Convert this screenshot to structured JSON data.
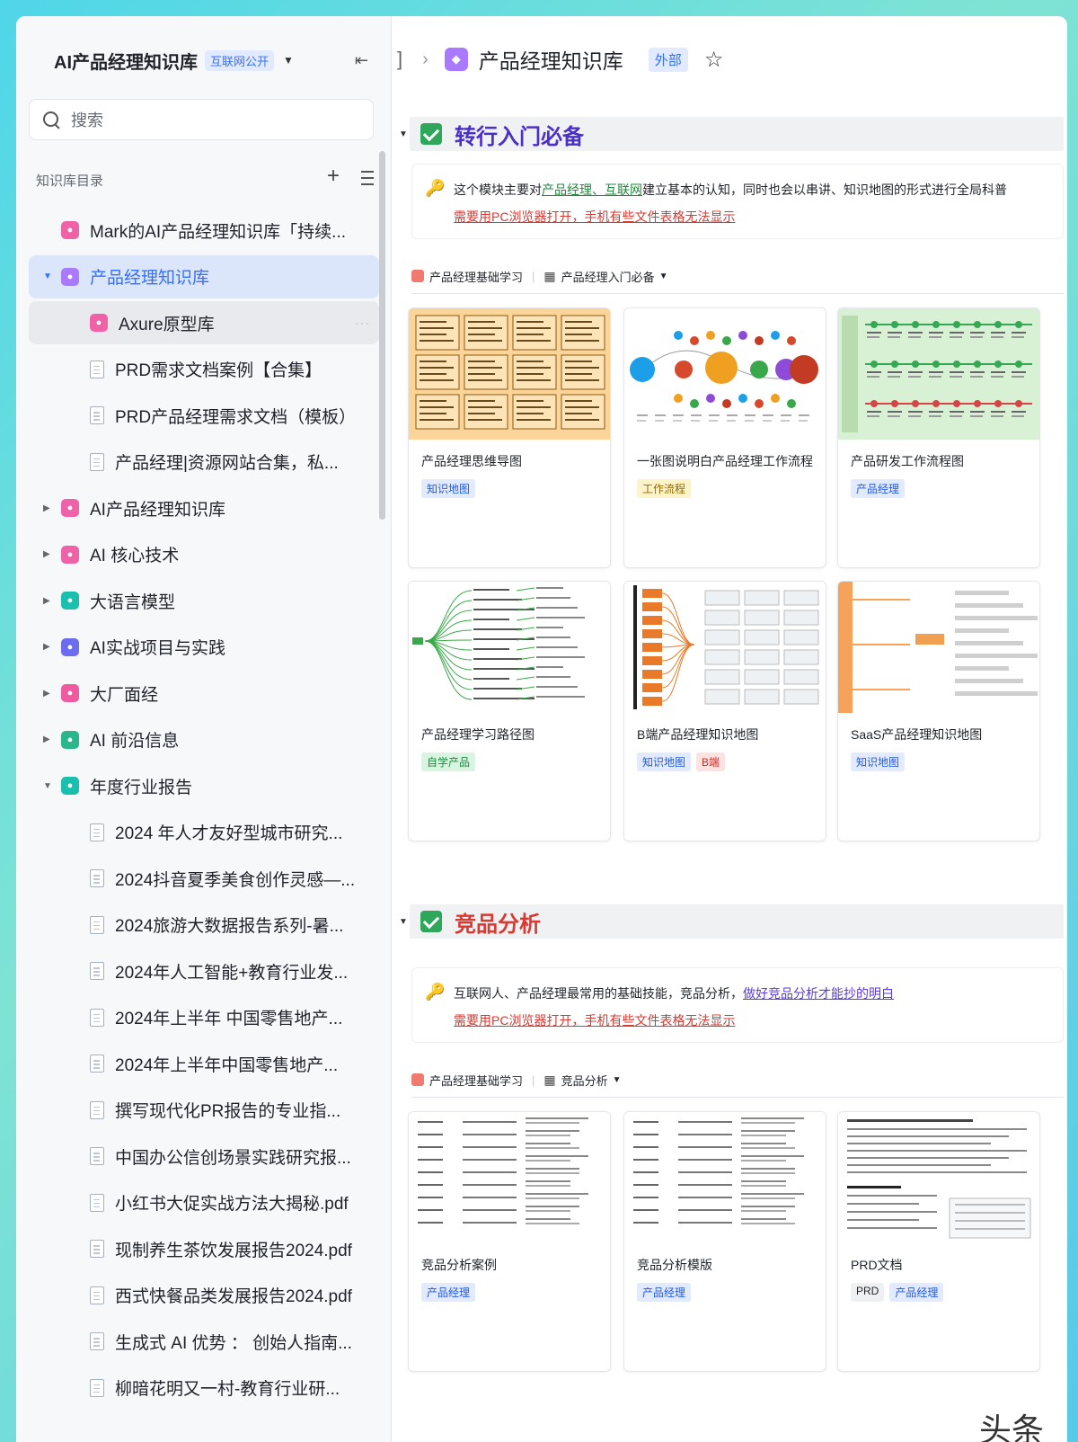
{
  "sidebar": {
    "title": "AI产品经理知识库",
    "visibility_tag": "互联网公开",
    "search_placeholder": "搜索",
    "directory_label": "知识库目录",
    "items": [
      {
        "label": "Mark的AI产品经理知识库「持续...",
        "kind": "space",
        "color": "#f062a8",
        "indent": 0
      },
      {
        "label": "产品经理知识库",
        "kind": "space",
        "color": "#a97aff",
        "indent": 0,
        "expanded": true,
        "active": true
      },
      {
        "label": "Axure原型库",
        "kind": "space",
        "color": "#f062a8",
        "indent": 1,
        "hover": true
      },
      {
        "label": "PRD需求文档案例【合集】",
        "kind": "doc",
        "indent": 1
      },
      {
        "label": "PRD产品经理需求文档（模板）",
        "kind": "doc",
        "indent": 1
      },
      {
        "label": "产品经理|资源网站合集，私...",
        "kind": "doc",
        "indent": 1
      },
      {
        "label": "AI产品经理知识库",
        "kind": "space",
        "color": "#f062a8",
        "indent": 0,
        "collapsed": true
      },
      {
        "label": "AI 核心技术",
        "kind": "space",
        "color": "#f062a8",
        "indent": 0,
        "collapsed": true
      },
      {
        "label": "大语言模型",
        "kind": "space",
        "color": "#1bbfae",
        "indent": 0,
        "collapsed": true
      },
      {
        "label": "AI实战项目与实践",
        "kind": "space",
        "color": "#6b6cf0",
        "indent": 0,
        "collapsed": true
      },
      {
        "label": "大厂面经",
        "kind": "space",
        "color": "#f05aa0",
        "indent": 0,
        "collapsed": true
      },
      {
        "label": "AI 前沿信息",
        "kind": "space",
        "color": "#2bb58a",
        "indent": 0,
        "collapsed": true
      },
      {
        "label": "年度行业报告",
        "kind": "space",
        "color": "#1bbfae",
        "indent": 0,
        "expanded": true
      },
      {
        "label": "2024 年人才友好型城市研究...",
        "kind": "doc",
        "indent": 1
      },
      {
        "label": "2024抖音夏季美食创作灵感—...",
        "kind": "doc",
        "indent": 1
      },
      {
        "label": "2024旅游大数据报告系列-暑...",
        "kind": "doc",
        "indent": 1
      },
      {
        "label": "2024年人工智能+教育行业发...",
        "kind": "doc",
        "indent": 1
      },
      {
        "label": "2024年上半年 中国零售地产...",
        "kind": "doc",
        "indent": 1
      },
      {
        "label": "2024年上半年中国零售地产...",
        "kind": "doc",
        "indent": 1
      },
      {
        "label": "撰写现代化PR报告的专业指...",
        "kind": "doc",
        "indent": 1
      },
      {
        "label": "中国办公信创场景实践研究报...",
        "kind": "doc",
        "indent": 1
      },
      {
        "label": "小红书大促实战方法大揭秘.pdf",
        "kind": "doc",
        "indent": 1
      },
      {
        "label": "现制养生茶饮发展报告2024.pdf",
        "kind": "doc",
        "indent": 1
      },
      {
        "label": "西式快餐品类发展报告2024.pdf",
        "kind": "doc",
        "indent": 1
      },
      {
        "label": "生成式 AI 优势 ： 创始人指南...",
        "kind": "doc",
        "indent": 1
      },
      {
        "label": "柳暗花明又一村-教育行业研...",
        "kind": "doc",
        "indent": 1
      }
    ]
  },
  "breadcrumb": {
    "title": "产品经理知识库",
    "tag": "外部"
  },
  "sections": [
    {
      "title": "转行入门必备",
      "title_color": "purple",
      "callout_parts": [
        "这个模块主要对",
        "产品经理、互联网",
        "建立基本的认知，同时也会以串讲、知识地图的形式进行全局科普"
      ],
      "callout_warning": "需要用PC浏览器打开，手机有些文件表格无法显示",
      "view_source": "产品经理基础学习",
      "view_name": "产品经理入门必备",
      "cards": [
        {
          "title": "产品经理思维导图",
          "tags": [
            {
              "text": "知识地图",
              "color": "blue"
            }
          ],
          "thumb": "orange-map"
        },
        {
          "title": "一张图说明白产品经理工作流程",
          "tags": [
            {
              "text": "工作流程",
              "color": "yellow"
            }
          ],
          "thumb": "flow"
        },
        {
          "title": "产品研发工作流程图",
          "tags": [
            {
              "text": "产品经理",
              "color": "blue"
            }
          ],
          "thumb": "green-flow"
        },
        {
          "title": "产品经理学习路径图",
          "tags": [
            {
              "text": "自学产品",
              "color": "green"
            }
          ],
          "thumb": "mind"
        },
        {
          "title": "B端产品经理知识地图",
          "tags": [
            {
              "text": "知识地图",
              "color": "blue"
            },
            {
              "text": "B端",
              "color": "red"
            }
          ],
          "thumb": "b-map"
        },
        {
          "title": "SaaS产品经理知识地图",
          "tags": [
            {
              "text": "知识地图",
              "color": "blue"
            }
          ],
          "thumb": "saas"
        }
      ]
    },
    {
      "title": "竞品分析",
      "title_color": "red",
      "callout_parts": [
        "互联网人、产品经理最常用的基础技能，竞品分析，",
        "做好竞品分析才能抄的明白"
      ],
      "callout_warning": "需要用PC浏览器打开，手机有些文件表格无法显示",
      "view_source": "产品经理基础学习",
      "view_name": "竞品分析",
      "cards": [
        {
          "title": "竞品分析案例",
          "tags": [
            {
              "text": "产品经理",
              "color": "blue"
            }
          ],
          "thumb": "doc"
        },
        {
          "title": "竞品分析模版",
          "tags": [
            {
              "text": "产品经理",
              "color": "blue"
            }
          ],
          "thumb": "doc"
        },
        {
          "title": "PRD文档",
          "tags": [
            {
              "text": "PRD",
              "color": "gray"
            },
            {
              "text": "产品经理",
              "color": "blue"
            }
          ],
          "thumb": "doc2"
        }
      ]
    }
  ],
  "watermark": "头条"
}
